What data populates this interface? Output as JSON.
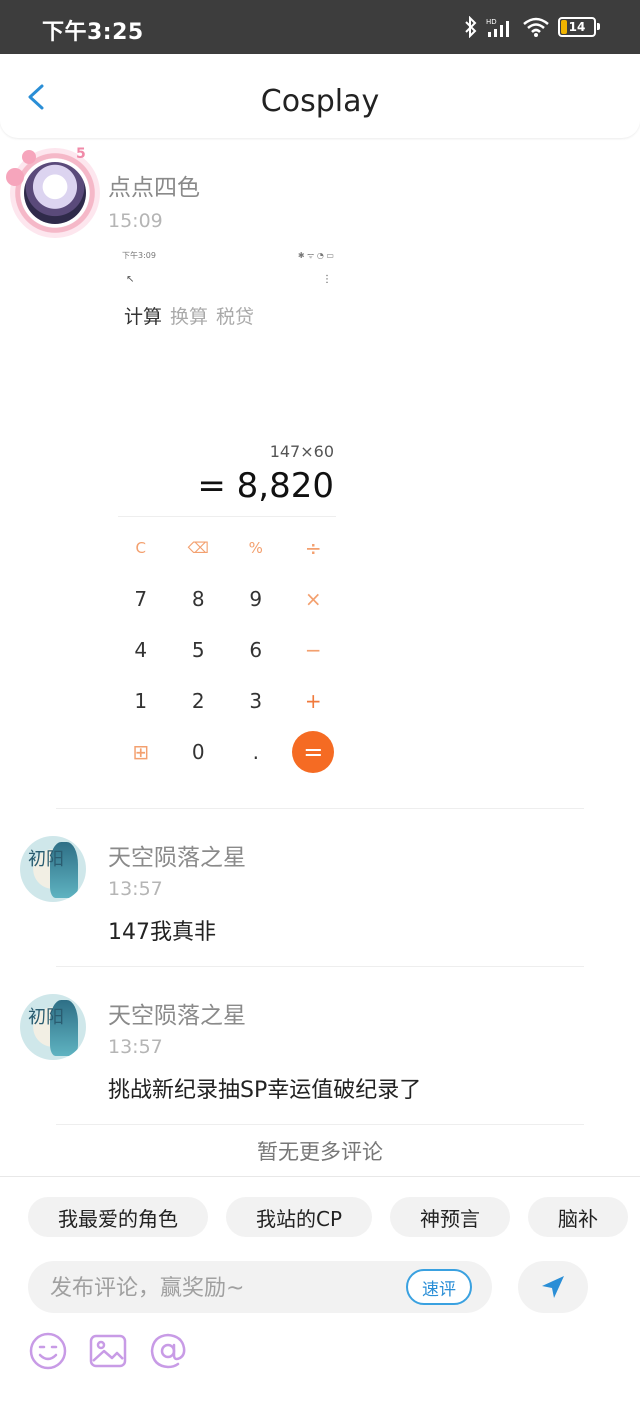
{
  "status_bar": {
    "time": "下午3:25",
    "battery": "14"
  },
  "nav": {
    "title": "Cosplay"
  },
  "post": {
    "username": "点点四色",
    "time": "15:09",
    "frame_badge": "5",
    "screenshot": {
      "status_time": "下午3:09",
      "status_icons": "✱ ᯤ ◔ ▭",
      "menu": "⋮",
      "arrow": "↖",
      "tabs": [
        "计算",
        "换算",
        "税贷"
      ],
      "expression": "147×60",
      "result": "= 8,820",
      "keys": [
        [
          "C",
          "⌫",
          "%",
          "÷"
        ],
        [
          "7",
          "8",
          "9",
          "×"
        ],
        [
          "4",
          "5",
          "6",
          "−"
        ],
        [
          "1",
          "2",
          "3",
          "+"
        ],
        [
          "⊞",
          "0",
          ".",
          "="
        ]
      ]
    }
  },
  "comments": [
    {
      "username": "天空陨落之星",
      "time": "13:57",
      "text": "147我真非",
      "avatar_text": "初阳"
    },
    {
      "username": "天空陨落之星",
      "time": "13:57",
      "text": "挑战新纪录抽SP幸运值破纪录了",
      "avatar_text": "初阳"
    }
  ],
  "no_more": "暂无更多评论",
  "bottom": {
    "chips": [
      "我最爱的角色",
      "我站的CP",
      "神预言",
      "脑补"
    ],
    "input_placeholder": "发布评论，赢奖励~",
    "quick_label": "速评",
    "tools": [
      "emoji-icon",
      "image-icon",
      "at-icon"
    ]
  },
  "colors": {
    "accent": "#2a8ed6",
    "orange": "#f56b23",
    "purple": "#c89be6"
  }
}
